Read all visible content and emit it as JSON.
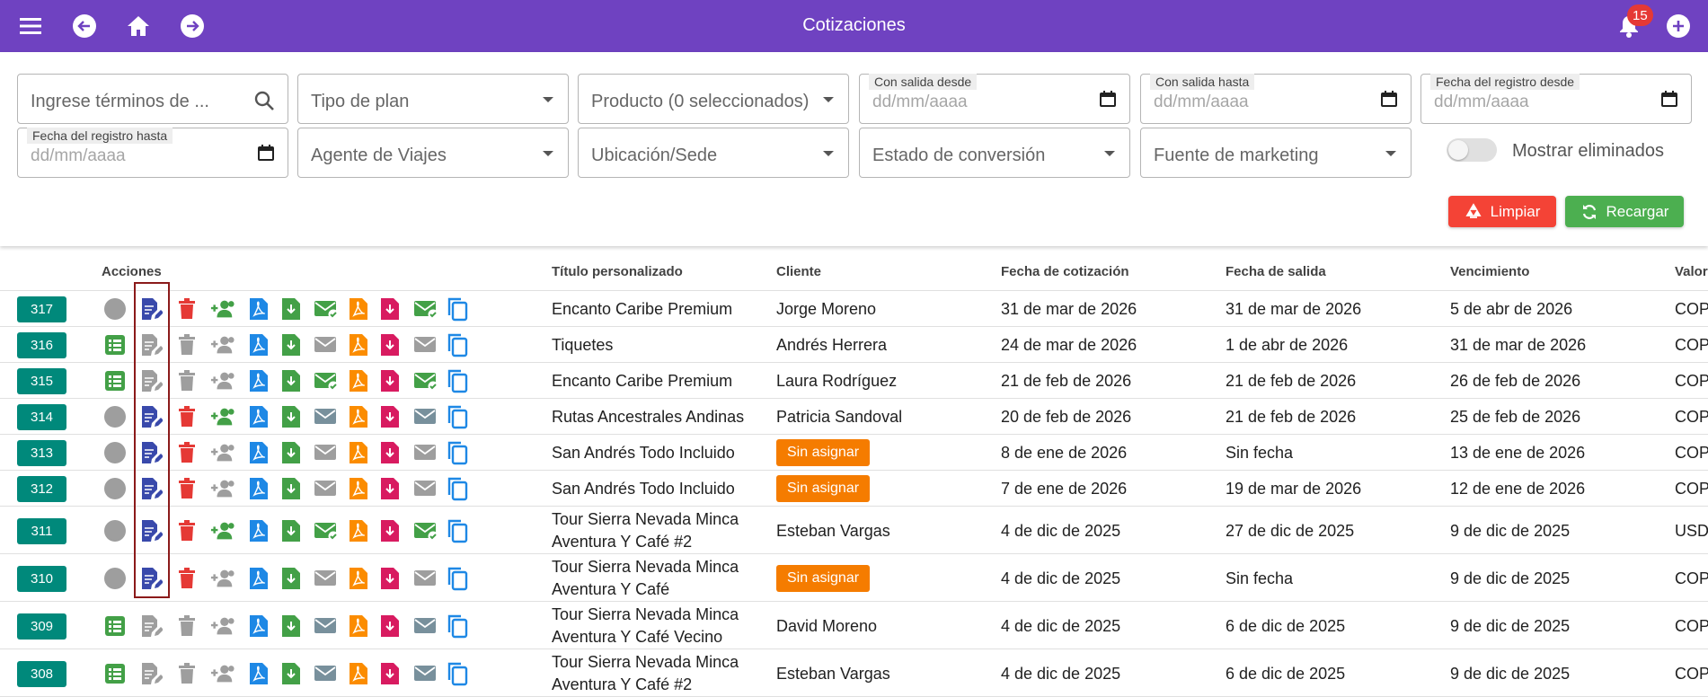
{
  "header": {
    "title": "Cotizaciones",
    "notification_count": "15"
  },
  "filters": {
    "search_placeholder": "Ingrese términos de ...",
    "plan_type": "Tipo de plan",
    "product": "Producto (0 seleccionados)",
    "departure_from_label": "Con salida desde",
    "departure_to_label": "Con salida hasta",
    "registered_from_label": "Fecha del registro desde",
    "registered_to_label": "Fecha del registro hasta",
    "date_placeholder": "dd/mm/aaaa",
    "travel_agent": "Agente de Viajes",
    "location": "Ubicación/Sede",
    "conversion_status": "Estado de conversión",
    "marketing_source": "Fuente de marketing",
    "show_deleted": "Mostrar eliminados",
    "clear_label": "Limpiar",
    "reload_label": "Recargar"
  },
  "columns": {
    "actions": "Acciones",
    "title": "Título personalizado",
    "client": "Cliente",
    "quote_date": "Fecha de cotización",
    "departure_date": "Fecha de salida",
    "expiration": "Vencimiento",
    "value": "Valor"
  },
  "colors": {
    "header_bg": "#6f42c1",
    "id_badge": "#00897b",
    "unassigned_chip": "#f57c00",
    "clear_button": "#f44336",
    "reload_button": "#4caf50",
    "highlight_border": "#8b1a1a"
  },
  "rows": [
    {
      "id": "317",
      "title1": "Encanto Caribe Premium",
      "title2": "",
      "client": "Jorge Moreno",
      "unassigned": false,
      "quote_date": "31 de mar de 2026",
      "departure": "31 de mar de 2026",
      "expiration": "5 de abr de 2026",
      "value": "COP",
      "active": true,
      "status_icon": "circle-icon",
      "user_icon": "green",
      "mail_status": "sent"
    },
    {
      "id": "316",
      "title1": "Tiquetes",
      "title2": "",
      "client": "Andrés Herrera",
      "unassigned": false,
      "quote_date": "24 de mar de 2026",
      "departure": "1 de abr de 2026",
      "expiration": "31 de mar de 2026",
      "value": "COP",
      "active": false,
      "status_icon": "list-icon",
      "user_icon": "gray",
      "mail_status": "gray"
    },
    {
      "id": "315",
      "title1": "Encanto Caribe Premium",
      "title2": "",
      "client": "Laura Rodríguez",
      "unassigned": false,
      "quote_date": "21 de feb de 2026",
      "departure": "21 de feb de 2026",
      "expiration": "26 de feb de 2026",
      "value": "COP",
      "active": false,
      "status_icon": "list-icon",
      "user_icon": "gray",
      "mail_status": "sent"
    },
    {
      "id": "314",
      "title1": "Rutas Ancestrales Andinas",
      "title2": "",
      "client": "Patricia Sandoval",
      "unassigned": false,
      "quote_date": "20 de feb de 2026",
      "departure": "21 de feb de 2026",
      "expiration": "25 de feb de 2026",
      "value": "COP",
      "active": true,
      "status_icon": "circle-icon",
      "user_icon": "green",
      "mail_status": "slate"
    },
    {
      "id": "313",
      "title1": "San Andrés Todo Incluido",
      "title2": "",
      "client": "Sin asignar",
      "unassigned": true,
      "quote_date": "8 de ene de 2026",
      "departure": "Sin fecha",
      "expiration": "13 de ene de 2026",
      "value": "COP",
      "active": true,
      "status_icon": "circle-icon",
      "user_icon": "gray",
      "mail_status": "gray"
    },
    {
      "id": "312",
      "title1": "San Andrés Todo Incluido",
      "title2": "",
      "client": "Sin asignar",
      "unassigned": true,
      "quote_date": "7 de ene de 2026",
      "departure": "19 de mar de 2026",
      "expiration": "12 de ene de 2026",
      "value": "COP",
      "active": true,
      "status_icon": "circle-icon",
      "user_icon": "gray",
      "mail_status": "gray"
    },
    {
      "id": "311",
      "title1": "Tour Sierra Nevada Minca",
      "title2": "Aventura Y Café #2",
      "client": "Esteban Vargas",
      "unassigned": false,
      "quote_date": "4 de dic de 2025",
      "departure": "27 de dic de 2025",
      "expiration": "9 de dic de 2025",
      "value": "USD",
      "active": true,
      "status_icon": "circle-icon",
      "user_icon": "green",
      "mail_status": "sent"
    },
    {
      "id": "310",
      "title1": "Tour Sierra Nevada Minca",
      "title2": "Aventura Y Café",
      "client": "Sin asignar",
      "unassigned": true,
      "quote_date": "4 de dic de 2025",
      "departure": "Sin fecha",
      "expiration": "9 de dic de 2025",
      "value": "COP",
      "active": true,
      "status_icon": "circle-icon",
      "user_icon": "gray",
      "mail_status": "gray"
    },
    {
      "id": "309",
      "title1": "Tour Sierra Nevada Minca",
      "title2": "Aventura Y Café Vecino",
      "client": "David Moreno",
      "unassigned": false,
      "quote_date": "4 de dic de 2025",
      "departure": "6 de dic de 2025",
      "expiration": "9 de dic de 2025",
      "value": "COP",
      "active": false,
      "status_icon": "list-icon",
      "user_icon": "gray",
      "mail_status": "slate"
    },
    {
      "id": "308",
      "title1": "Tour Sierra Nevada Minca",
      "title2": "Aventura Y Café #2",
      "client": "Esteban Vargas",
      "unassigned": false,
      "quote_date": "4 de dic de 2025",
      "departure": "6 de dic de 2025",
      "expiration": "9 de dic de 2025",
      "value": "COP",
      "active": false,
      "status_icon": "list-icon",
      "user_icon": "gray",
      "mail_status": "slate"
    }
  ]
}
